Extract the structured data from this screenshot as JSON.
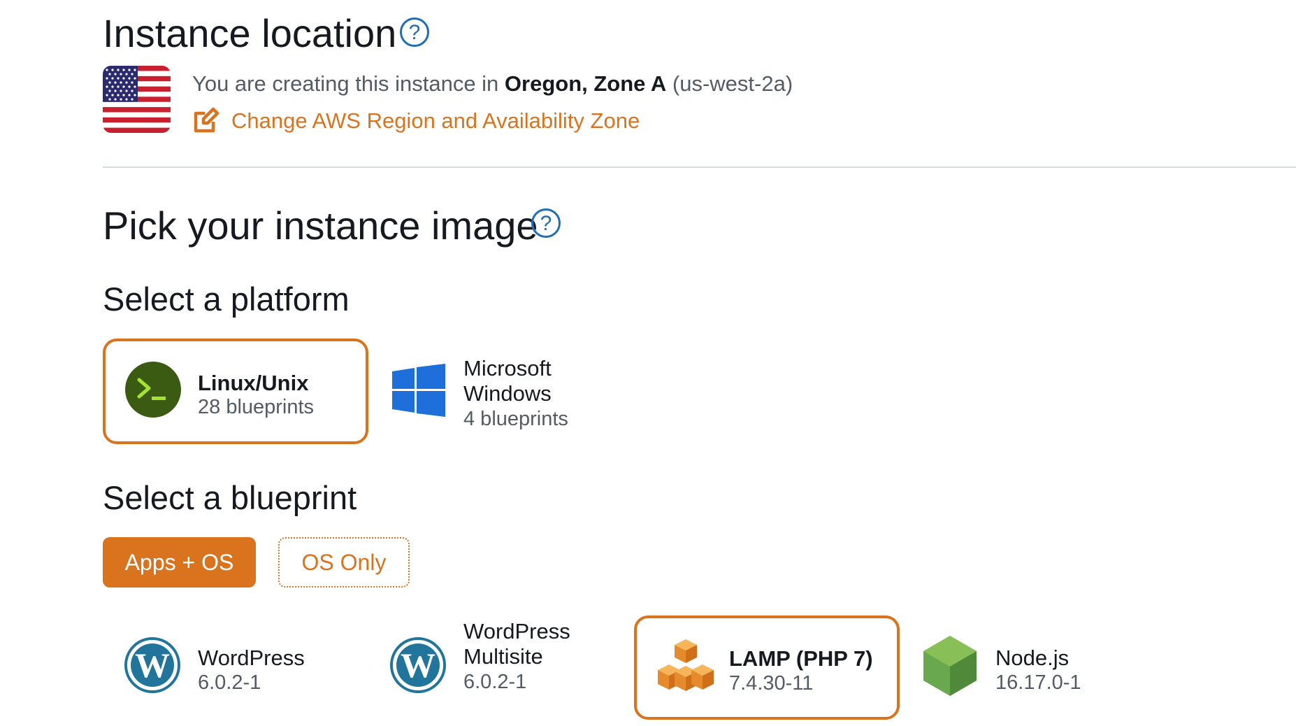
{
  "location": {
    "title": "Instance location",
    "prefix": "You are creating this instance in ",
    "region": "Oregon, Zone A",
    "zone_code": "(us-west-2a)",
    "change_link": "Change AWS Region and Availability Zone"
  },
  "image": {
    "title": "Pick your instance image"
  },
  "platform": {
    "title": "Select a platform",
    "options": [
      {
        "name": "Linux/Unix",
        "count": "28 blueprints",
        "selected": true,
        "icon": "terminal-icon"
      },
      {
        "name_line1": "Microsoft",
        "name_line2": "Windows",
        "count": "4 blueprints",
        "selected": false,
        "icon": "windows-logo-icon"
      }
    ]
  },
  "blueprint": {
    "title": "Select a blueprint",
    "tabs": [
      {
        "label": "Apps + OS",
        "active": true
      },
      {
        "label": "OS Only",
        "active": false
      }
    ],
    "items": [
      {
        "name": "WordPress",
        "version": "6.0.2-1",
        "icon": "wordpress-icon",
        "selected": false
      },
      {
        "name_line1": "WordPress",
        "name_line2": "Multisite",
        "version": "6.0.2-1",
        "icon": "wordpress-icon",
        "selected": false
      },
      {
        "name": "LAMP (PHP 7)",
        "version": "7.4.30-11",
        "icon": "cubes-icon",
        "selected": true
      },
      {
        "name": "Node.js",
        "version": "16.17.0-1",
        "icon": "nodejs-icon",
        "selected": false
      }
    ]
  },
  "colors": {
    "accent": "#d9731e",
    "text": "#16191f",
    "muted": "#545b64",
    "help_blue": "#1f6eb4"
  }
}
